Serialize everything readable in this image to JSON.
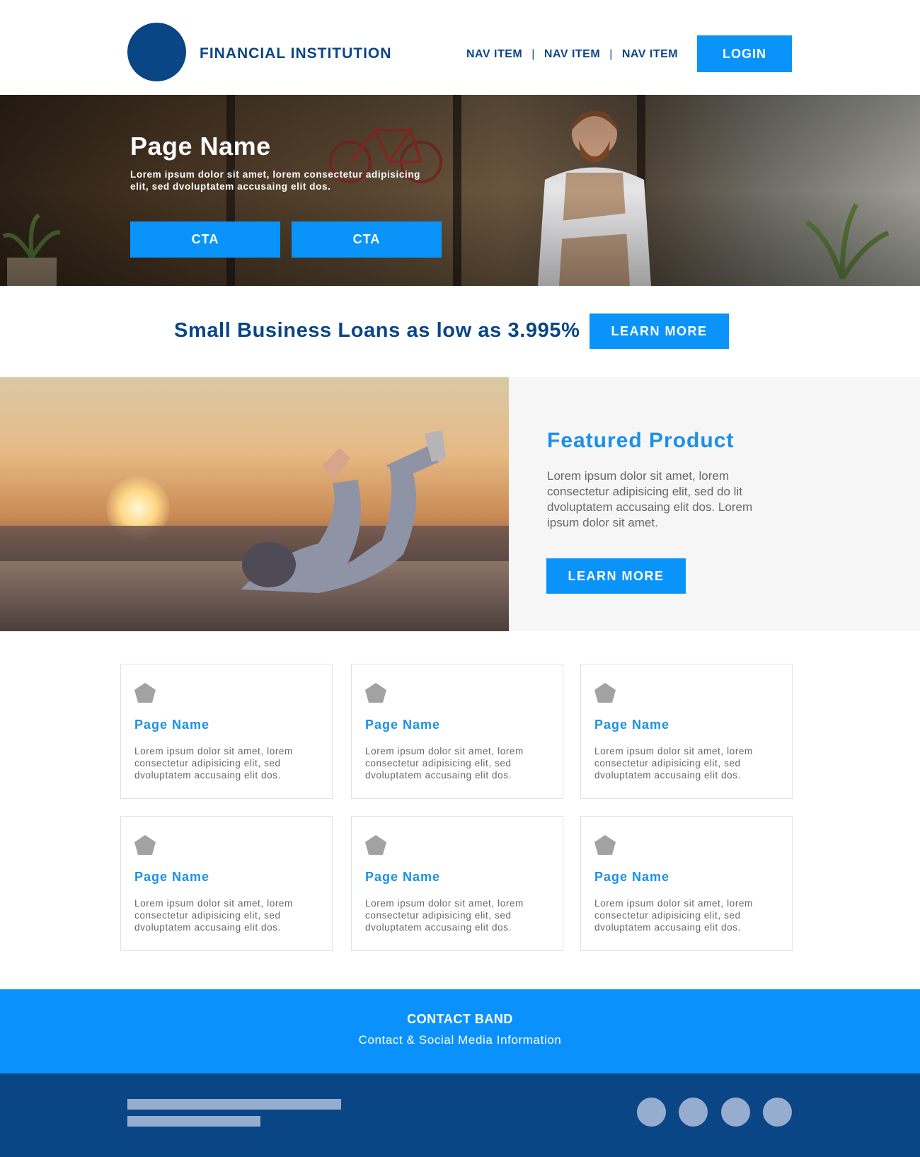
{
  "header": {
    "brand": "FINANCIAL INSTITUTION",
    "nav": [
      "NAV ITEM",
      "NAV ITEM",
      "NAV ITEM"
    ],
    "separator": "|",
    "login_label": "LOGIN"
  },
  "hero": {
    "title": "Page Name",
    "subtitle": "Lorem ipsum dolor sit amet, lorem consectetur adipisicing elit, sed dvoluptatem accusaing elit dos.",
    "cta_primary": "CTA",
    "cta_secondary": "CTA"
  },
  "promo": {
    "text": "Small Business Loans as low as 3.995%",
    "button": "LEARN MORE"
  },
  "featured": {
    "title": "Featured Product",
    "body": "Lorem ipsum dolor sit amet, lorem consectetur adipisicing elit, sed do lit dvoluptatem accusaing elit dos. Lorem ipsum dolor sit amet.",
    "button": "LEARN MORE"
  },
  "cards": [
    {
      "icon": "pentagon-icon",
      "title": "Page Name",
      "body": "Lorem ipsum dolor sit amet, lorem consectetur adipisicing elit, sed dvoluptatem accusaing elit dos."
    },
    {
      "icon": "pentagon-icon",
      "title": "Page Name",
      "body": "Lorem ipsum dolor sit amet, lorem consectetur adipisicing elit, sed dvoluptatem accusaing elit dos."
    },
    {
      "icon": "pentagon-icon",
      "title": "Page Name",
      "body": "Lorem ipsum dolor sit amet, lorem consectetur adipisicing elit, sed dvoluptatem accusaing elit dos."
    },
    {
      "icon": "pentagon-icon",
      "title": "Page Name",
      "body": "Lorem ipsum dolor sit amet, lorem consectetur adipisicing elit, sed dvoluptatem accusaing elit dos."
    },
    {
      "icon": "pentagon-icon",
      "title": "Page Name",
      "body": "Lorem ipsum dolor sit amet, lorem consectetur adipisicing elit, sed dvoluptatem accusaing elit dos."
    },
    {
      "icon": "pentagon-icon",
      "title": "Page Name",
      "body": "Lorem ipsum dolor sit amet, lorem consectetur adipisicing elit, sed dvoluptatem accusaing elit dos."
    }
  ],
  "contact": {
    "heading": "CONTACT BAND",
    "subheading": "Contact & Social Media Information"
  },
  "footer": {
    "social_icons": [
      "social-icon",
      "social-icon",
      "social-icon",
      "social-icon"
    ]
  },
  "colors": {
    "brand_navy": "#0a4586",
    "accent_blue": "#0a94fa",
    "heading_blue": "#1991ea",
    "footer_placeholder": "#96add0"
  }
}
